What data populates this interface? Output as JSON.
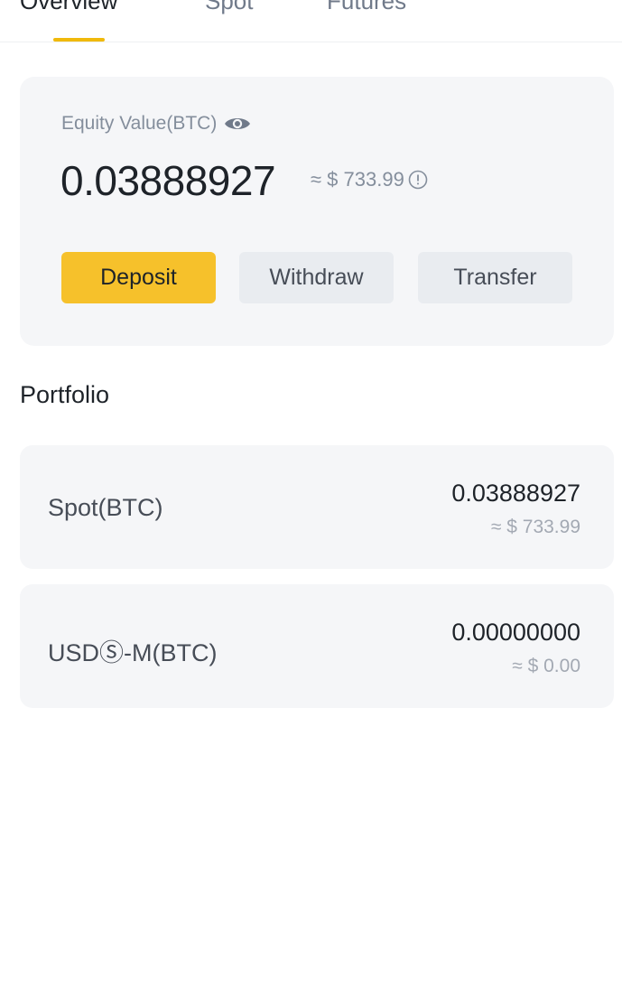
{
  "tabs": [
    {
      "label": "Overview",
      "active": true
    },
    {
      "label": "Spot",
      "active": false
    },
    {
      "label": "Futures",
      "active": false
    }
  ],
  "equity": {
    "label": "Equity Value(BTC)",
    "value": "0.03888927",
    "fiat": "≈ $ 733.99",
    "visibility_icon": "eye-icon",
    "info_icon": "info-icon"
  },
  "actions": {
    "deposit": "Deposit",
    "withdraw": "Withdraw",
    "transfer": "Transfer"
  },
  "portfolio": {
    "title": "Portfolio",
    "items": [
      {
        "label": "Spot(BTC)",
        "value": "0.03888927",
        "fiat": "≈ $ 733.99"
      },
      {
        "label": "USDⓈ-M(BTC)",
        "value": "0.00000000",
        "fiat": "≈ $ 0.00"
      }
    ]
  },
  "colors": {
    "accent": "#f0b90b",
    "deposit_button": "#f6c12b",
    "card_background": "#f5f6f8",
    "secondary_button": "#e9ecf0"
  }
}
